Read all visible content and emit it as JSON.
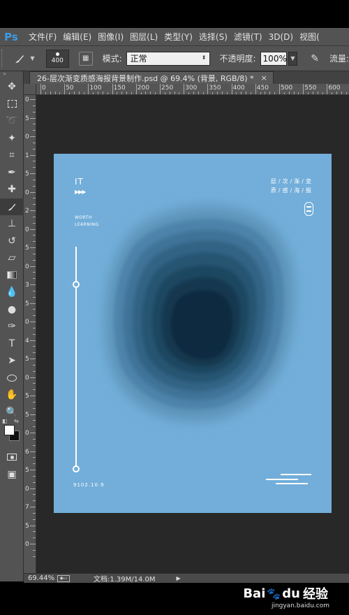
{
  "app": {
    "logo": "Ps"
  },
  "menu": [
    "文件(F)",
    "编辑(E)",
    "图像(I)",
    "图层(L)",
    "类型(Y)",
    "选择(S)",
    "滤镜(T)",
    "3D(D)",
    "视图("
  ],
  "options": {
    "brush_size": "400",
    "mode_label": "模式:",
    "mode_value": "正常",
    "opacity_label": "不透明度:",
    "opacity_value": "100%",
    "flow_label": "流量:"
  },
  "document": {
    "tab_title": "26-层次渐变质感海报背景制作.psd @ 69.4% (背景, RGB/8) *",
    "close": "×"
  },
  "ruler_h": [
    "0",
    "50",
    "100",
    "150",
    "200",
    "250",
    "300",
    "350",
    "400",
    "450",
    "500",
    "550",
    "600"
  ],
  "ruler_v": [
    "0",
    "5",
    "0",
    "1",
    "5",
    "0",
    "2",
    "0",
    "5",
    "0",
    "3",
    "5",
    "0",
    "4",
    "5",
    "0",
    "5",
    "5",
    "0",
    "6",
    "5",
    "0",
    "7",
    "5",
    "0"
  ],
  "poster": {
    "it": "IT",
    "arrows": "▶▶▶",
    "worth": "WORTH\nLEARNING",
    "title": "层/次/渐/变\n质/感/海/报",
    "date": "9102.10.9",
    "bg_color": "#72aed9",
    "center_color": "#0d2a3e"
  },
  "tools": [
    "move-icon",
    "marquee-icon",
    "lasso-icon",
    "magic-wand-icon",
    "crop-icon",
    "eyedropper-icon",
    "healing-icon",
    "brush-icon",
    "stamp-icon",
    "history-brush-icon",
    "eraser-icon",
    "gradient-icon",
    "blur-icon",
    "dodge-icon",
    "pen-icon",
    "type-icon",
    "path-select-icon",
    "shape-icon",
    "hand-icon",
    "zoom-icon"
  ],
  "status": {
    "zoom": "69.44%",
    "doc": "文档:1.39M/14.0M"
  },
  "watermark": {
    "brand": "Bai",
    "brand2": "经验",
    "paw": "du",
    "url": "jingyan.baidu.com"
  }
}
